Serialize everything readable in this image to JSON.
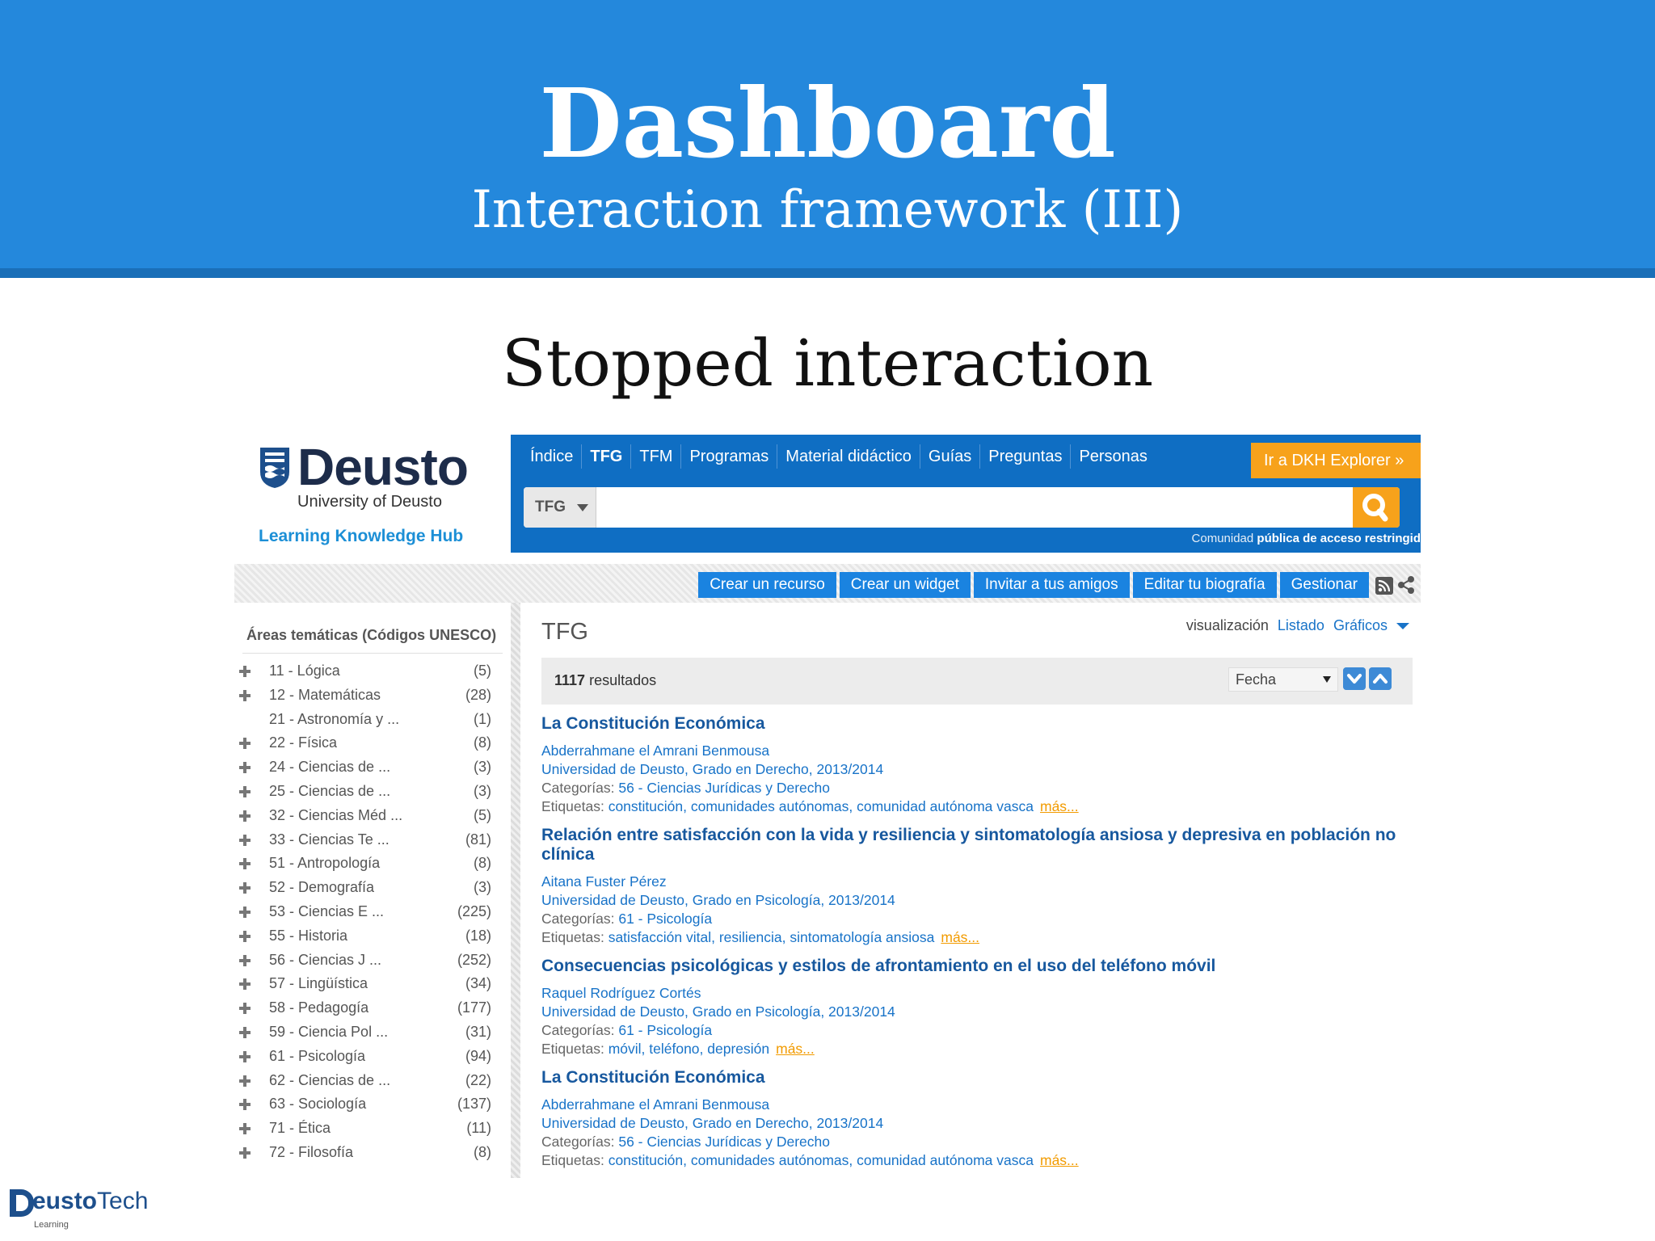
{
  "slide": {
    "title": "Dashboard",
    "subtitle": "Interaction framework (III)",
    "section": "Stopped interaction"
  },
  "logo": {
    "name": "Deusto",
    "university": "University of Deusto",
    "hub": "Learning Knowledge Hub"
  },
  "nav": {
    "items": [
      "Índice",
      "TFG",
      "TFM",
      "Programas",
      "Material didáctico",
      "Guías",
      "Preguntas",
      "Personas"
    ],
    "active": "TFG",
    "explorer_button": "Ir a DKH Explorer »"
  },
  "search": {
    "scope": "TFG",
    "placeholder": "",
    "community_prefix": "Comunidad",
    "community_bold": "pública de acceso restringid"
  },
  "actions": [
    "Crear un recurso",
    "Crear un widget",
    "Invitar a tus amigos",
    "Editar tu biografía",
    "Gestionar"
  ],
  "sidebar": {
    "title": "Áreas temáticas (Códigos UNESCO)",
    "items": [
      {
        "label": "11 - Lógica",
        "count": "(5)",
        "expandable": true
      },
      {
        "label": "12 - Matemáticas",
        "count": "(28)",
        "expandable": true
      },
      {
        "label": "21 - Astronomía y ...",
        "count": "(1)",
        "expandable": false
      },
      {
        "label": "22 - Física",
        "count": "(8)",
        "expandable": true
      },
      {
        "label": "24 - Ciencias de ...",
        "count": "(3)",
        "expandable": true
      },
      {
        "label": "25 - Ciencias de ...",
        "count": "(3)",
        "expandable": true
      },
      {
        "label": "32 - Ciencias Méd ...",
        "count": "(5)",
        "expandable": true
      },
      {
        "label": "33 - Ciencias Te ...",
        "count": "(81)",
        "expandable": true
      },
      {
        "label": "51 - Antropología",
        "count": "(8)",
        "expandable": true
      },
      {
        "label": "52 - Demografía",
        "count": "(3)",
        "expandable": true
      },
      {
        "label": "53 - Ciencias E ...",
        "count": "(225)",
        "expandable": true
      },
      {
        "label": "55 - Historia",
        "count": "(18)",
        "expandable": true
      },
      {
        "label": "56 - Ciencias J ...",
        "count": "(252)",
        "expandable": true
      },
      {
        "label": "57 - Lingüística",
        "count": "(34)",
        "expandable": true
      },
      {
        "label": "58 - Pedagogía",
        "count": "(177)",
        "expandable": true
      },
      {
        "label": "59 - Ciencia Pol ...",
        "count": "(31)",
        "expandable": true
      },
      {
        "label": "61 - Psicología",
        "count": "(94)",
        "expandable": true
      },
      {
        "label": "62 - Ciencias de ...",
        "count": "(22)",
        "expandable": true
      },
      {
        "label": "63 - Sociología",
        "count": "(137)",
        "expandable": true
      },
      {
        "label": "71 - Ética",
        "count": "(11)",
        "expandable": true
      },
      {
        "label": "72 - Filosofía",
        "count": "(8)",
        "expandable": true
      }
    ]
  },
  "main": {
    "title": "TFG",
    "visualization_label": "visualización",
    "view_list": "Listado",
    "view_charts": "Gráficos",
    "results_count": "1117",
    "results_label": "resultados",
    "sort": "Fecha",
    "categories_label": "Categorías:",
    "tags_label": "Etiquetas:",
    "more_label": "más...",
    "results": [
      {
        "title": "La Constitución Económica",
        "author": "Abderrahmane el Amrani Benmousa",
        "institution": "Universidad de Deusto, Grado en Derecho, 2013/2014",
        "category": "56 - Ciencias Jurídicas y Derecho",
        "tags": "constitución, comunidades autónomas, comunidad autónoma vasca"
      },
      {
        "title": "Relación entre satisfacción con la vida y resiliencia y sintomatología ansiosa y depresiva en población no clínica",
        "author": "Aitana Fuster Pérez",
        "institution": "Universidad de Deusto, Grado en Psicología, 2013/2014",
        "category": "61 - Psicología",
        "tags": "satisfacción vital, resiliencia, sintomatología ansiosa"
      },
      {
        "title": "Consecuencias psicológicas y estilos de afrontamiento en el uso del teléfono móvil",
        "author": "Raquel Rodríguez Cortés",
        "institution": "Universidad de Deusto, Grado en Psicología, 2013/2014",
        "category": "61 - Psicología",
        "tags": "móvil, teléfono, depresión"
      },
      {
        "title": "La Constitución Económica",
        "author": "Abderrahmane el Amrani Benmousa",
        "institution": "Universidad de Deusto, Grado en Derecho, 2013/2014",
        "category": "56 - Ciencias Jurídicas y Derecho",
        "tags": "constitución, comunidades autónomas, comunidad autónoma vasca"
      }
    ]
  },
  "footer_logo": {
    "brand_bold": "eusto",
    "brand_light": "Tech",
    "tagline": "Learning"
  },
  "colors": {
    "slide_blue": "#2488dc",
    "nav_blue": "#0f6ec3",
    "accent_orange": "#f7a21b",
    "link_blue": "#1873c8"
  },
  "icons": [
    "shield-icon",
    "search-icon",
    "rss-icon",
    "share-icon",
    "plus-icon",
    "chevron-down-icon",
    "chevron-up-icon"
  ]
}
